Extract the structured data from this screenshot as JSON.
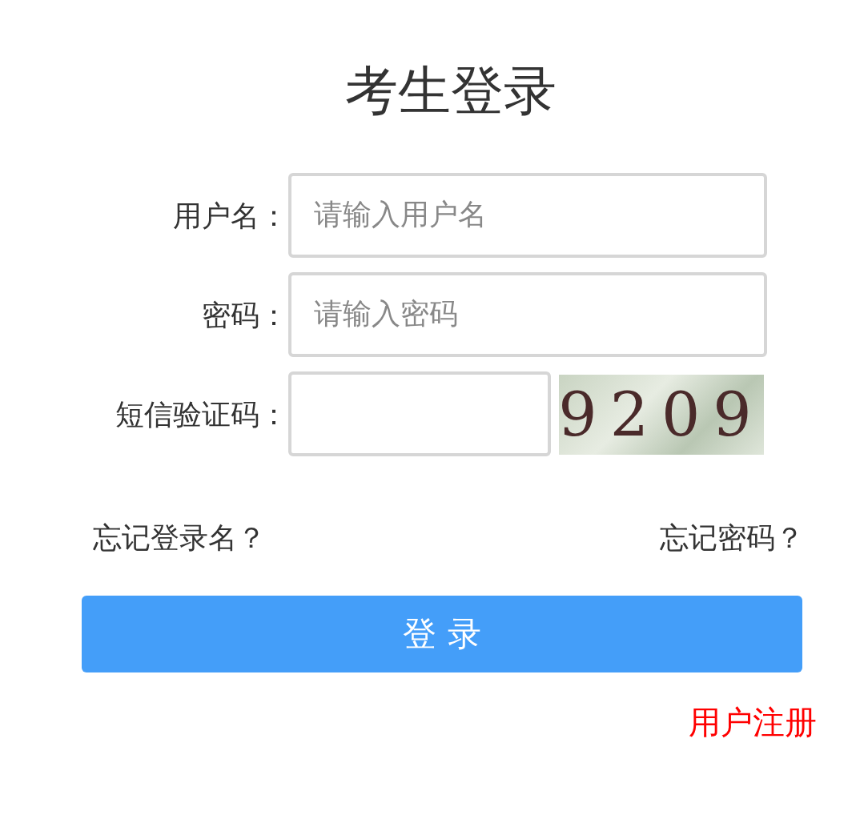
{
  "title": "考生登录",
  "fields": [
    {
      "label": "用户名：",
      "placeholder": "请输入用户名"
    },
    {
      "label": "密码：",
      "placeholder": "请输入密码"
    }
  ],
  "captcha": {
    "label": "短信验证码：",
    "code": "9209"
  },
  "links": [
    "忘记登录名？",
    "忘记密码？"
  ],
  "login_button": "登 录",
  "register_link": "用户注册"
}
